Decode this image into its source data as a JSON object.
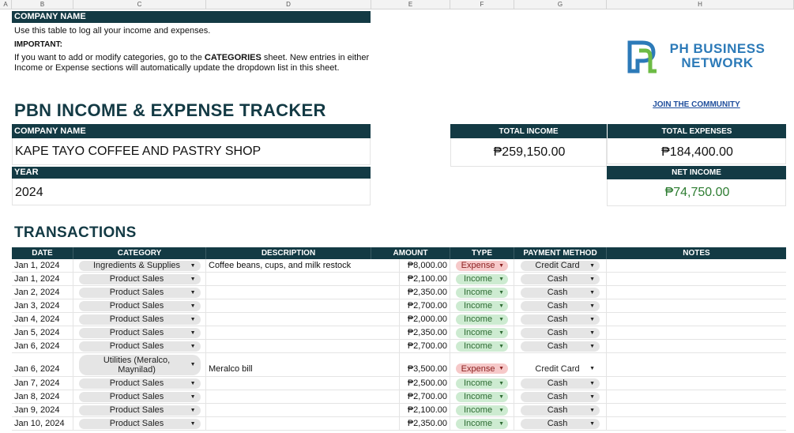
{
  "sheet": {
    "columns": [
      "A",
      "B",
      "C",
      "D",
      "E",
      "F",
      "G",
      "H"
    ]
  },
  "info": {
    "header": "COMPANY NAME",
    "line1": "Use this table to log all your income and expenses.",
    "important": "IMPORTANT:",
    "line2_pre": "If you want to add or modify categories, go to the ",
    "line2_bold": "CATEGORIES",
    "line2_post": " sheet. New entries in either Income or Expense sections will automatically update the dropdown list in this sheet."
  },
  "logo": {
    "line1": "PH BUSINESS",
    "line2": "NETWORK",
    "join": "JOIN THE COMMUNITY"
  },
  "title": "PBN INCOME & EXPENSE TRACKER",
  "company": {
    "label": "COMPANY NAME",
    "value": "KAPE TAYO COFFEE AND PASTRY SHOP"
  },
  "year": {
    "label": "YEAR",
    "value": "2024"
  },
  "totals": {
    "income_label": "TOTAL INCOME",
    "income_value": "₱259,150.00",
    "expenses_label": "TOTAL EXPENSES",
    "expenses_value": "₱184,400.00",
    "net_label": "NET INCOME",
    "net_value": "₱74,750.00"
  },
  "transactions": {
    "heading": "TRANSACTIONS",
    "headers": {
      "date": "DATE",
      "category": "CATEGORY",
      "description": "DESCRIPTION",
      "amount": "AMOUNT",
      "type": "TYPE",
      "payment": "PAYMENT METHOD",
      "notes": "NOTES"
    },
    "rows": [
      {
        "date": "Jan 1, 2024",
        "category": "Ingredients & Supplies",
        "description": "Coffee beans, cups, and milk restock",
        "amount": "₱8,000.00",
        "type": "Expense",
        "payment": "Credit Card"
      },
      {
        "date": "Jan 1, 2024",
        "category": "Product Sales",
        "description": "",
        "amount": "₱2,100.00",
        "type": "Income",
        "payment": "Cash"
      },
      {
        "date": "Jan 2, 2024",
        "category": "Product Sales",
        "description": "",
        "amount": "₱2,350.00",
        "type": "Income",
        "payment": "Cash"
      },
      {
        "date": "Jan 3, 2024",
        "category": "Product Sales",
        "description": "",
        "amount": "₱2,700.00",
        "type": "Income",
        "payment": "Cash"
      },
      {
        "date": "Jan 4, 2024",
        "category": "Product Sales",
        "description": "",
        "amount": "₱2,000.00",
        "type": "Income",
        "payment": "Cash"
      },
      {
        "date": "Jan 5, 2024",
        "category": "Product Sales",
        "description": "",
        "amount": "₱2,350.00",
        "type": "Income",
        "payment": "Cash"
      },
      {
        "date": "Jan 6, 2024",
        "category": "Product Sales",
        "description": "",
        "amount": "₱2,700.00",
        "type": "Income",
        "payment": "Cash"
      },
      {
        "date": "Jan 6, 2024",
        "category": "Utilities (Meralco, Maynilad)",
        "description": "Meralco bill",
        "amount": "₱3,500.00",
        "type": "Expense",
        "payment": "Credit Card"
      },
      {
        "date": "Jan 7, 2024",
        "category": "Product Sales",
        "description": "",
        "amount": "₱2,500.00",
        "type": "Income",
        "payment": "Cash"
      },
      {
        "date": "Jan 8, 2024",
        "category": "Product Sales",
        "description": "",
        "amount": "₱2,700.00",
        "type": "Income",
        "payment": "Cash"
      },
      {
        "date": "Jan 9, 2024",
        "category": "Product Sales",
        "description": "",
        "amount": "₱2,100.00",
        "type": "Income",
        "payment": "Cash"
      },
      {
        "date": "Jan 10, 2024",
        "category": "Product Sales",
        "description": "",
        "amount": "₱2,350.00",
        "type": "Income",
        "payment": "Cash"
      }
    ]
  },
  "colors": {
    "dark_teal": "#133a44",
    "income_green": "#2e7d32",
    "expense_chip": "#f6c9c9",
    "income_chip": "#cdebd1",
    "logo_blue": "#2c7ab8",
    "logo_green": "#6dbb45"
  },
  "icons": {
    "dropdown": "caret-down-icon",
    "logo": "pbn-logo-icon"
  }
}
